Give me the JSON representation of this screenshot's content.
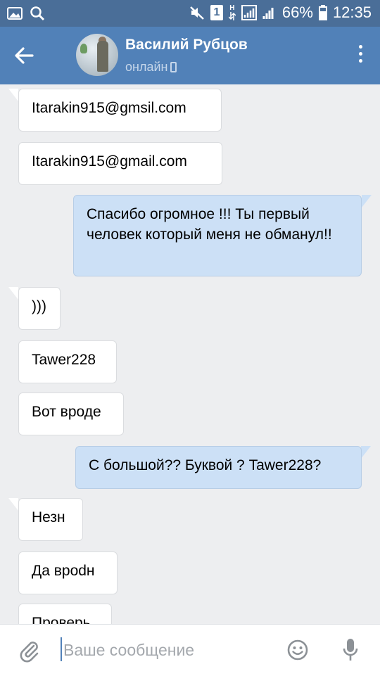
{
  "status_bar": {
    "sim_badge": "1",
    "network_letter": "H",
    "battery": "66%",
    "time": "12:35"
  },
  "header": {
    "contact_name": "Василий Рубцов",
    "contact_status": "онлайн"
  },
  "messages": [
    {
      "direction": "in",
      "text": "Itarakin915@gmsil.com"
    },
    {
      "direction": "in",
      "text": "Itarakin915@gmail.com"
    },
    {
      "direction": "out",
      "text": "Спасибо огромное !!! Ты первый человек который меня не обманул!!"
    },
    {
      "direction": "in",
      "text": ")))"
    },
    {
      "direction": "in",
      "text": "Tawer228"
    },
    {
      "direction": "in",
      "text": "Вот вроде"
    },
    {
      "direction": "out",
      "text": "С большой?? Буквой ? Tawer228?"
    },
    {
      "direction": "in",
      "text": "Незн"
    },
    {
      "direction": "in",
      "text": "Да врodн"
    },
    {
      "direction": "in",
      "text": "Проверь"
    }
  ],
  "composer": {
    "placeholder": "Ваше сообщение"
  },
  "colors": {
    "status_bar": "#4a6e98",
    "header": "#5181b8",
    "incoming_bubble": "#ffffff",
    "outgoing_bubble": "#cce0f6",
    "chat_background": "#edeef0"
  }
}
